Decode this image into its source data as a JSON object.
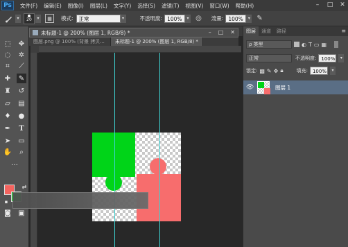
{
  "app": {
    "logo": "Ps",
    "menus": [
      "文件(F)",
      "编辑(E)",
      "图像(I)",
      "图层(L)",
      "文字(Y)",
      "选择(S)",
      "滤镜(T)",
      "视图(V)",
      "窗口(W)",
      "帮助(H)"
    ]
  },
  "options": {
    "brush_size": "20",
    "mode_label": "模式:",
    "mode_value": "正常",
    "opacity_label": "不透明度:",
    "opacity_value": "100%",
    "flow_label": "流量:",
    "flow_value": "100%"
  },
  "document": {
    "title": "未标题-1 @ 200% (图层 1, RGB/8) *",
    "tabs": [
      "图层.png @ 100% (背景 拷贝...",
      "未标题-1 @ 200% (图层 1, RGB/8) *"
    ]
  },
  "colors": {
    "foreground": "#f5645f",
    "background": "#00d418",
    "guide": "#3fd1d1",
    "green": "#00d418",
    "red": "#f76d6d"
  },
  "layers_panel": {
    "tabs": [
      "图层",
      "通道",
      "路径"
    ],
    "filter_label": "ρ 类型",
    "blend_mode": "正常",
    "opacity_label": "不透明度:",
    "opacity_value": "100%",
    "lock_label": "锁定:",
    "fill_label": "填充:",
    "fill_value": "100%",
    "layer_name": "图层 1"
  }
}
